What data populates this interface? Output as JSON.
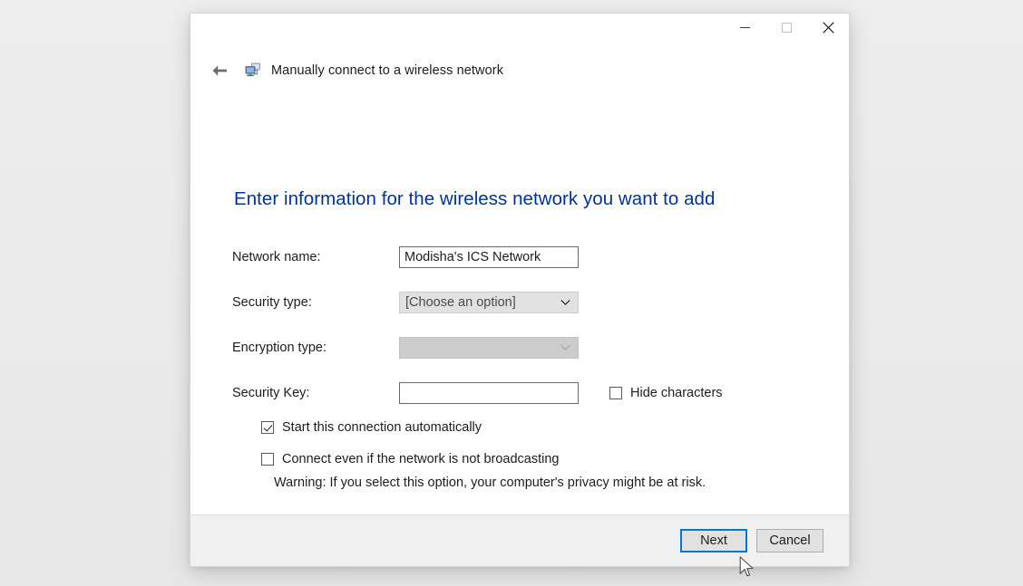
{
  "window": {
    "titlebar": {
      "minimize_label": "Minimize",
      "maximize_label": "Maximize",
      "close_label": "Close"
    },
    "header": {
      "back_label": "Back",
      "icon": "wireless-network-icon",
      "title": "Manually connect to a wireless network"
    }
  },
  "main": {
    "heading": "Enter information for the wireless network you want to add",
    "fields": [
      {
        "label": "Network name:",
        "value": "Modisha's ICS Network",
        "placeholder": "",
        "type": "text"
      },
      {
        "label": "Security type:",
        "value": "[Choose an option]",
        "type": "combobox",
        "disabled": false
      },
      {
        "label": "Encryption type:",
        "value": "",
        "type": "combobox",
        "disabled": true
      },
      {
        "label": "Security Key:",
        "value": "",
        "placeholder": "",
        "type": "text"
      }
    ],
    "hide_characters": {
      "label": "Hide characters",
      "checked": false
    },
    "options": [
      {
        "label": "Start this connection automatically",
        "checked": true
      },
      {
        "label": "Connect even if the network is not broadcasting",
        "checked": false
      }
    ],
    "warning": "Warning: If you select this option, your computer's privacy might be at risk."
  },
  "footer": {
    "next_label": "Next",
    "cancel_label": "Cancel"
  },
  "colors": {
    "heading_blue": "#003399",
    "focus_blue": "#0078d7",
    "footer_bg": "#f0f0f0",
    "disabled_gray": "#cccccc",
    "combo_gray": "#e1e1e1"
  }
}
